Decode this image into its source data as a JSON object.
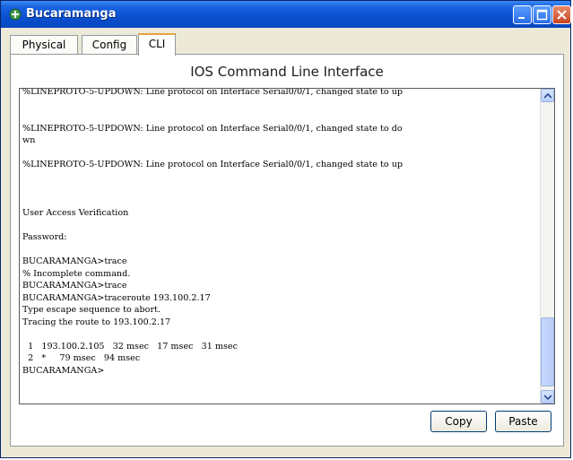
{
  "window": {
    "title": "Bucaramanga",
    "icon": "router-icon"
  },
  "tabs": [
    {
      "label": "Physical",
      "active": false
    },
    {
      "label": "Config",
      "active": false
    },
    {
      "label": "CLI",
      "active": true
    }
  ],
  "panel": {
    "title": "IOS Command Line Interface"
  },
  "terminal": {
    "lines": [
      "%LINEPROTO-5-UPDOWN: Line protocol on Interface Serial0/0/1, changed state to up",
      "",
      "",
      "%LINEPROTO-5-UPDOWN: Line protocol on Interface Serial0/0/1, changed state to do",
      "wn",
      "",
      "%LINEPROTO-5-UPDOWN: Line protocol on Interface Serial0/0/1, changed state to up",
      "",
      "",
      "",
      "User Access Verification",
      "",
      "Password:",
      "",
      "BUCARAMANGA>trace",
      "% Incomplete command.",
      "BUCARAMANGA>trace",
      "BUCARAMANGA>traceroute 193.100.2.17",
      "Type escape sequence to abort.",
      "Tracing the route to 193.100.2.17",
      "",
      "  1   193.100.2.105   32 msec   17 msec   31 msec",
      "  2   *     79 msec   94 msec",
      "BUCARAMANGA>"
    ]
  },
  "buttons": {
    "copy": "Copy",
    "paste": "Paste"
  },
  "colors": {
    "titlebar": "#0a4fd0",
    "active_tab_accent": "#e8a33a",
    "window_bg": "#ece9d8"
  }
}
